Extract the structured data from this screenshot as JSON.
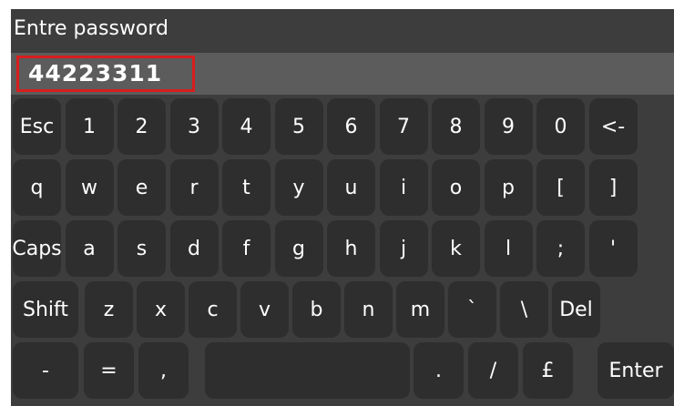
{
  "prompt": {
    "title": "Entre password"
  },
  "password": {
    "value": "44223311"
  },
  "keyboard": {
    "rows": [
      [
        {
          "label": "Esc",
          "name": "esc-key"
        },
        {
          "label": "1",
          "name": "key-1"
        },
        {
          "label": "2",
          "name": "key-2"
        },
        {
          "label": "3",
          "name": "key-3"
        },
        {
          "label": "4",
          "name": "key-4"
        },
        {
          "label": "5",
          "name": "key-5"
        },
        {
          "label": "6",
          "name": "key-6"
        },
        {
          "label": "7",
          "name": "key-7"
        },
        {
          "label": "8",
          "name": "key-8"
        },
        {
          "label": "9",
          "name": "key-9"
        },
        {
          "label": "0",
          "name": "key-0"
        },
        {
          "label": "<-",
          "name": "backspace-key"
        }
      ],
      [
        {
          "label": "q",
          "name": "key-q"
        },
        {
          "label": "w",
          "name": "key-w"
        },
        {
          "label": "e",
          "name": "key-e"
        },
        {
          "label": "r",
          "name": "key-r"
        },
        {
          "label": "t",
          "name": "key-t"
        },
        {
          "label": "y",
          "name": "key-y"
        },
        {
          "label": "u",
          "name": "key-u"
        },
        {
          "label": "i",
          "name": "key-i"
        },
        {
          "label": "o",
          "name": "key-o"
        },
        {
          "label": "p",
          "name": "key-p"
        },
        {
          "label": "[",
          "name": "key-left-bracket"
        },
        {
          "label": "]",
          "name": "key-right-bracket"
        }
      ],
      [
        {
          "label": "Caps",
          "name": "caps-key"
        },
        {
          "label": "a",
          "name": "key-a"
        },
        {
          "label": "s",
          "name": "key-s"
        },
        {
          "label": "d",
          "name": "key-d"
        },
        {
          "label": "f",
          "name": "key-f"
        },
        {
          "label": "g",
          "name": "key-g"
        },
        {
          "label": "h",
          "name": "key-h"
        },
        {
          "label": "j",
          "name": "key-j"
        },
        {
          "label": "k",
          "name": "key-k"
        },
        {
          "label": "l",
          "name": "key-l"
        },
        {
          "label": ";",
          "name": "key-semicolon"
        },
        {
          "label": "'",
          "name": "key-apostrophe"
        }
      ],
      [
        {
          "label": "Shift",
          "name": "shift-key"
        },
        {
          "label": "z",
          "name": "key-z"
        },
        {
          "label": "x",
          "name": "key-x"
        },
        {
          "label": "c",
          "name": "key-c"
        },
        {
          "label": "v",
          "name": "key-v"
        },
        {
          "label": "b",
          "name": "key-b"
        },
        {
          "label": "n",
          "name": "key-n"
        },
        {
          "label": "m",
          "name": "key-m"
        },
        {
          "label": "`",
          "name": "key-backtick"
        },
        {
          "label": "\\",
          "name": "key-backslash"
        },
        {
          "label": "Del",
          "name": "delete-key"
        }
      ],
      [
        {
          "label": "-",
          "name": "key-minus"
        },
        {
          "label": "=",
          "name": "key-equals"
        },
        {
          "label": ",",
          "name": "key-comma"
        },
        {
          "label": "",
          "name": "space-key"
        },
        {
          "label": ".",
          "name": "key-period"
        },
        {
          "label": "/",
          "name": "key-slash"
        },
        {
          "label": "£",
          "name": "key-pound"
        },
        {
          "label": "Enter",
          "name": "enter-key"
        }
      ]
    ]
  }
}
